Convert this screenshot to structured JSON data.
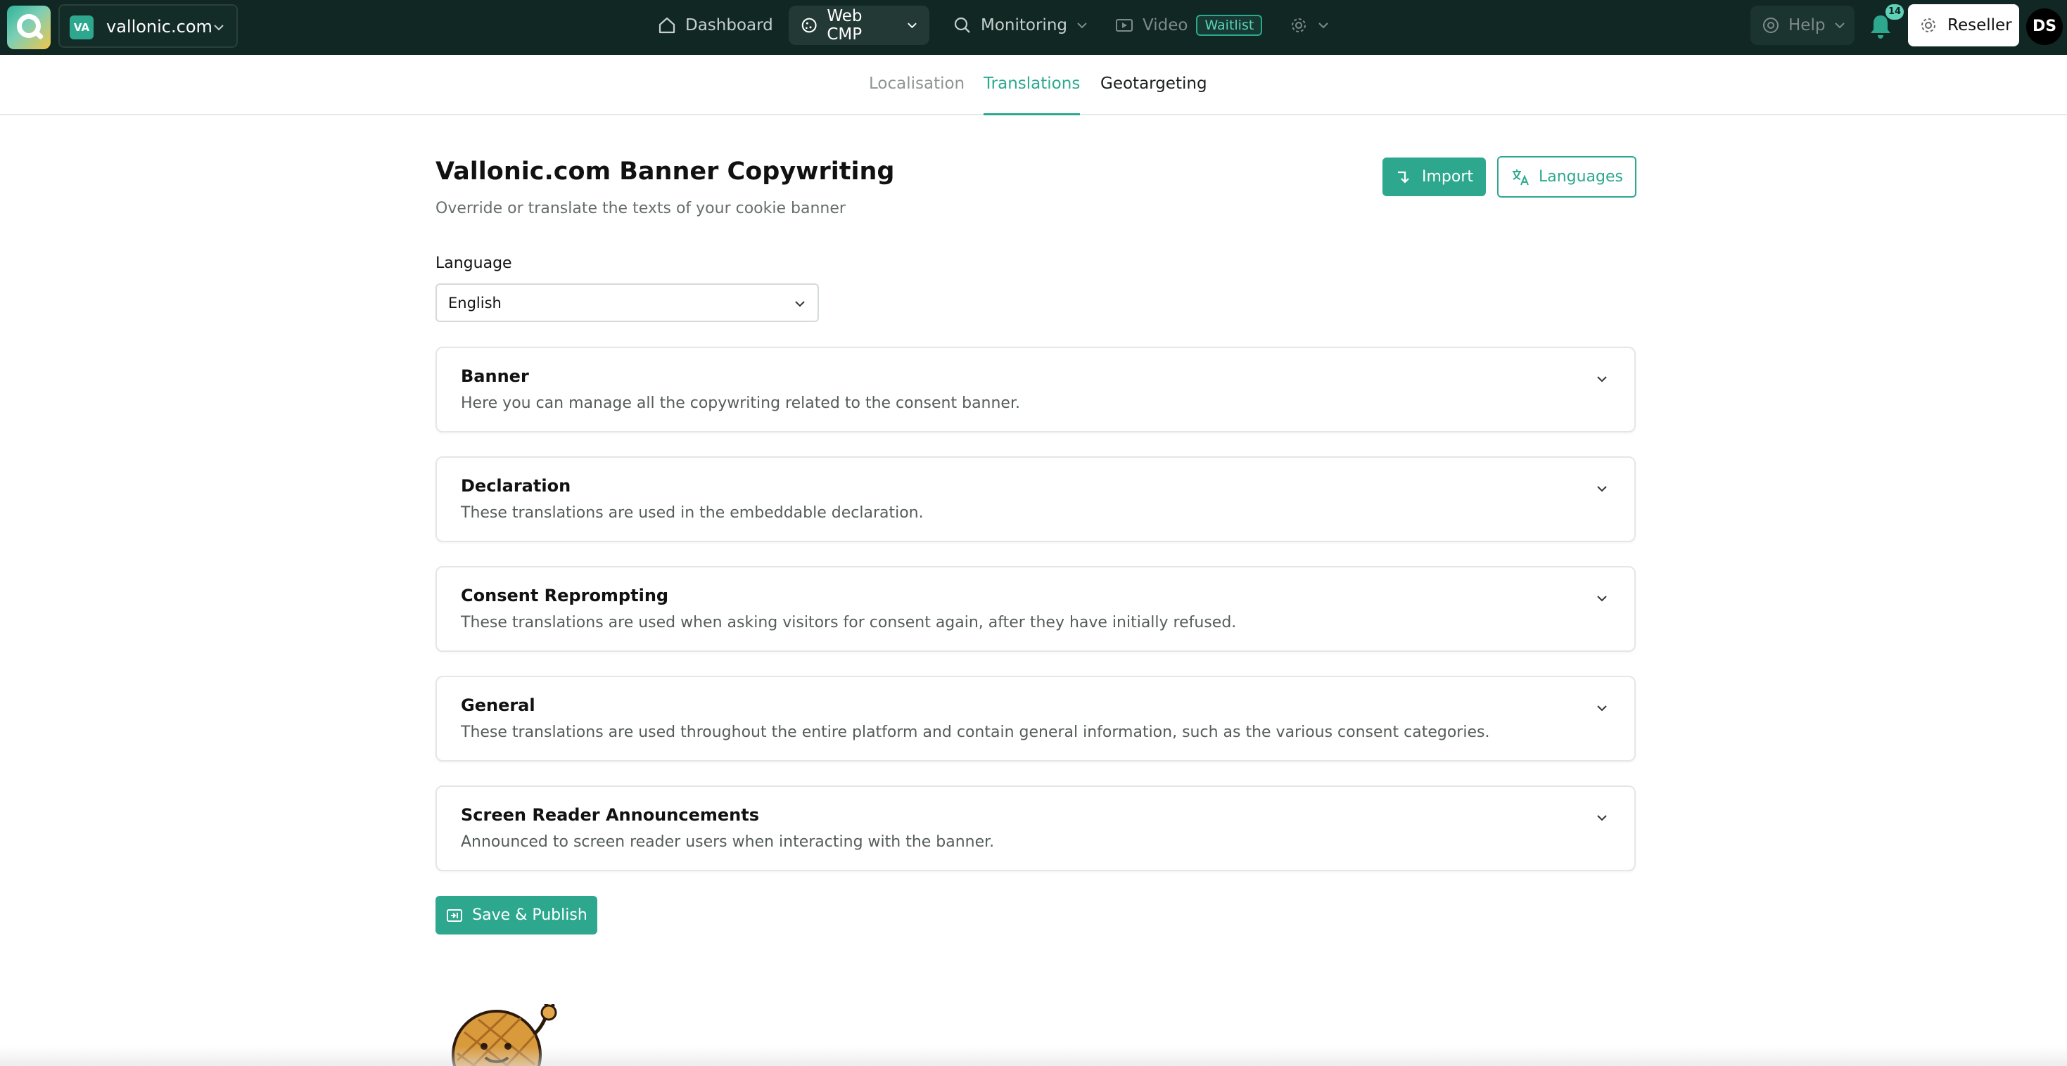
{
  "topbar": {
    "site_badge": "VA",
    "site_name": "vallonic.com",
    "nav": [
      {
        "label": "Dashboard"
      },
      {
        "label": "Web CMP"
      },
      {
        "label": "Monitoring"
      },
      {
        "label": "Video",
        "badge": "Waitlist"
      }
    ],
    "help_label": "Help",
    "notification_count": "14",
    "reseller_label": "Reseller",
    "avatar_initials": "DS"
  },
  "subtabs": [
    {
      "label": "Localisation"
    },
    {
      "label": "Translations"
    },
    {
      "label": "Geotargeting"
    }
  ],
  "main": {
    "title": "Vallonic.com Banner Copywriting",
    "subtitle": "Override or translate the texts of your cookie banner",
    "import_label": "Import",
    "languages_label": "Languages",
    "language_label": "Language",
    "language_value": "English",
    "sections": [
      {
        "title": "Banner",
        "description": "Here you can manage all the copywriting related to the consent banner."
      },
      {
        "title": "Declaration",
        "description": "These translations are used in the embeddable declaration."
      },
      {
        "title": "Consent Reprompting",
        "description": "These translations are used when asking visitors for consent again, after they have initially refused."
      },
      {
        "title": "General",
        "description": "These translations are used throughout the entire platform and contain general information, such as the various consent categories."
      },
      {
        "title": "Screen Reader Announcements",
        "description": "Announced to screen reader users when interacting with the banner."
      }
    ],
    "save_label": "Save & Publish"
  },
  "colors": {
    "topbar_bg": "#112723",
    "accent": "#2da88f",
    "text": "#111111",
    "muted": "#555d5b"
  },
  "icons": [
    "logo",
    "chevron-down-icon",
    "home-icon",
    "cookie-icon",
    "search-icon",
    "video-icon",
    "gear-icon",
    "lifebuoy-icon",
    "bell-icon",
    "import-icon",
    "translate-icon",
    "save-icon"
  ]
}
